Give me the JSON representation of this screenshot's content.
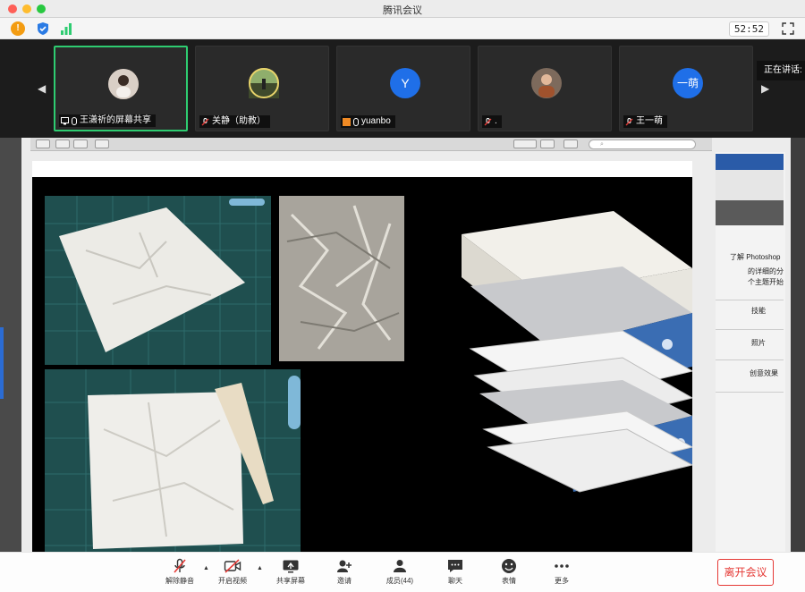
{
  "window": {
    "title": "腾讯会议",
    "timer": "52:52"
  },
  "participants": [
    {
      "name": "王潇祈的屏幕共享",
      "avatar_text": "",
      "avatar_color": "#8a6e5e",
      "mic": "on",
      "sharing": true,
      "active": true
    },
    {
      "name": "关静（助教）",
      "avatar_text": "",
      "avatar_color": "#6b7d5c",
      "mic": "muted",
      "sharing": false,
      "active": false
    },
    {
      "name": "yuanbo",
      "avatar_text": "Y",
      "avatar_color": "#1f6fe8",
      "mic": "on",
      "sharing": false,
      "active": false
    },
    {
      "name": ".",
      "avatar_text": "",
      "avatar_color": "#9a6f55",
      "mic": "muted",
      "sharing": false,
      "active": false
    },
    {
      "name": "王一萌",
      "avatar_text": "一萌",
      "avatar_color": "#1f6fe8",
      "mic": "muted",
      "sharing": false,
      "active": false
    }
  ],
  "speaking_label": "正在讲话:",
  "ps_panel": {
    "heading": "了解 Photoshop",
    "lines": [
      "的详细的分步指",
      "个主题开始教",
      "技能",
      "照片",
      "创意效果"
    ]
  },
  "controls": [
    {
      "label": "解除静音",
      "icon": "mic-muted-icon"
    },
    {
      "label": "开启视频",
      "icon": "video-off-icon"
    },
    {
      "label": "共享屏幕",
      "icon": "share-screen-icon"
    },
    {
      "label": "邀请",
      "icon": "invite-icon"
    },
    {
      "label": "成员(44)",
      "icon": "members-icon"
    },
    {
      "label": "聊天",
      "icon": "chat-icon"
    },
    {
      "label": "表情",
      "icon": "emoji-icon"
    },
    {
      "label": "更多",
      "icon": "more-icon"
    }
  ],
  "leave_label": "离开会议",
  "colors": {
    "active_border": "#2ecc71",
    "leave": "#e53935",
    "avatar_blue": "#1f6fe8"
  }
}
